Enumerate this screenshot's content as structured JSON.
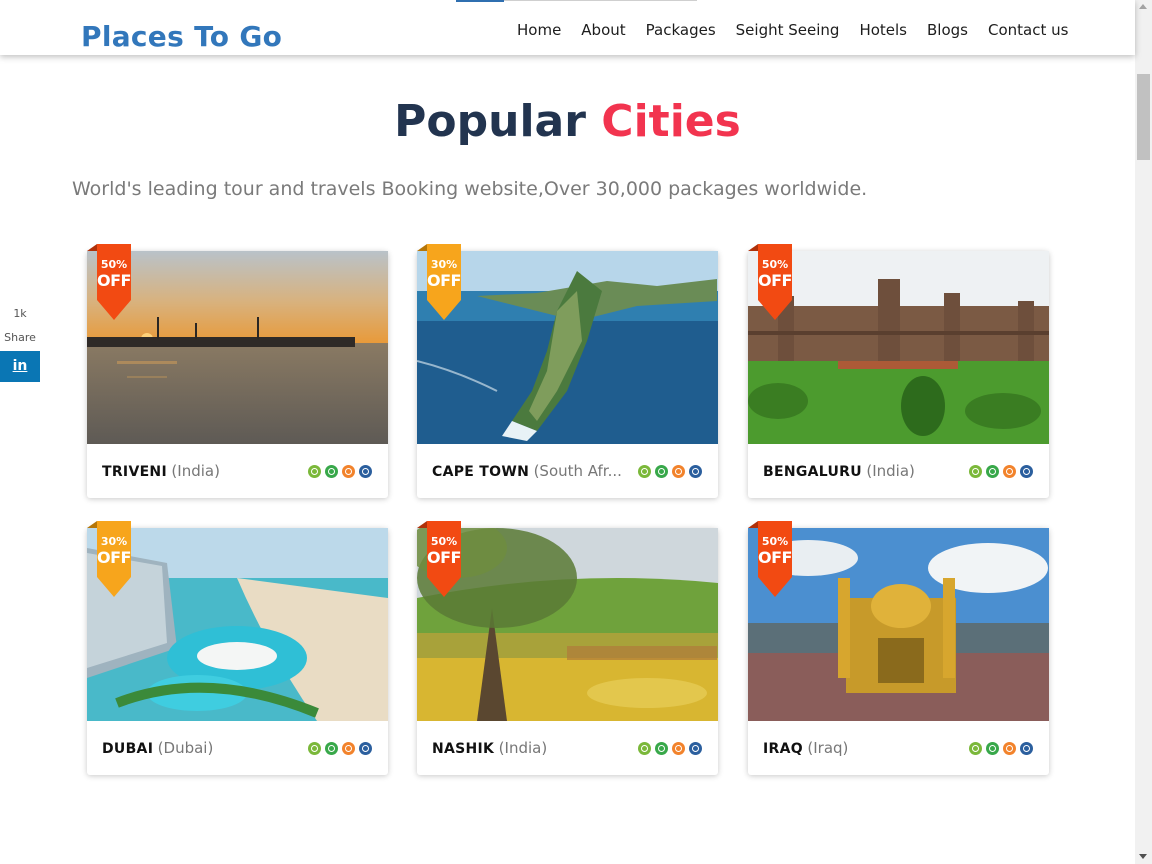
{
  "header": {
    "logo": "Places To Go",
    "nav": [
      {
        "label": "Home"
      },
      {
        "label": "About"
      },
      {
        "label": "Packages"
      },
      {
        "label": "Seight Seeing"
      },
      {
        "label": "Hotels"
      },
      {
        "label": "Blogs"
      },
      {
        "label": "Contact us"
      }
    ]
  },
  "share": {
    "count": "1k",
    "label": "Share",
    "button": "in"
  },
  "section": {
    "title_part1": "Popular",
    "title_part2": "Cities",
    "subtitle": "World's leading tour and travels Booking website,Over 30,000 packages worldwide."
  },
  "colors": {
    "brand": "#3277bb",
    "title_dark": "#22344f",
    "title_accent": "#f2344f",
    "ribbon_red": "#f24a12",
    "ribbon_orange": "#f7a51c"
  },
  "cards": [
    {
      "city": "TRIVENI",
      "country": "(India)",
      "discount": "50%",
      "off": "OFF",
      "ribbon": "red",
      "icons": [
        "clock-icon",
        "money-icon",
        "tag-icon",
        "pin-icon"
      ]
    },
    {
      "city": "CAPE TOWN",
      "country": "(South Afr...",
      "discount": "30%",
      "off": "OFF",
      "ribbon": "orange",
      "icons": [
        "clock-icon",
        "money-icon",
        "tag-icon",
        "pin-icon"
      ]
    },
    {
      "city": "BENGALURU",
      "country": "(India)",
      "discount": "50%",
      "off": "OFF",
      "ribbon": "red",
      "icons": [
        "clock-icon",
        "money-icon",
        "tag-icon",
        "pin-icon"
      ]
    },
    {
      "city": "DUBAI",
      "country": "(Dubai)",
      "discount": "30%",
      "off": "OFF",
      "ribbon": "orange",
      "icons": [
        "clock-icon",
        "money-icon",
        "tag-icon",
        "pin-icon"
      ]
    },
    {
      "city": "NASHIK",
      "country": "(India)",
      "discount": "50%",
      "off": "OFF",
      "ribbon": "red",
      "icons": [
        "clock-icon",
        "money-icon",
        "tag-icon",
        "pin-icon"
      ]
    },
    {
      "city": "IRAQ",
      "country": "(Iraq)",
      "discount": "50%",
      "off": "OFF",
      "ribbon": "red",
      "icons": [
        "clock-icon",
        "money-icon",
        "tag-icon",
        "pin-icon"
      ]
    }
  ]
}
